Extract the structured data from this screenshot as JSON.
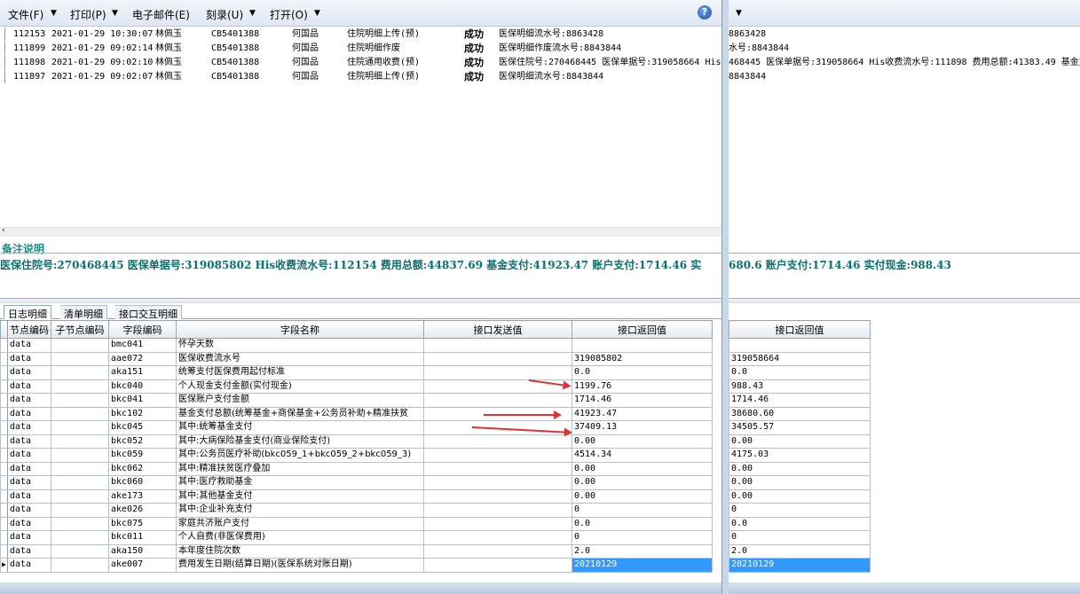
{
  "menu": {
    "file": "文件(F)",
    "print": "打印(P)",
    "email": "电子邮件(E)",
    "burn": "刻录(U)",
    "open": "打开(O)",
    "dropdown": "▼",
    "help_icon": "?"
  },
  "log_rows": [
    {
      "id": "112153",
      "time": "2021-01-29 10:30:07",
      "user": "林佩玉",
      "card": "CB5401388",
      "doctor": "何国品",
      "op": "住院明细上传(预)",
      "status": "成功",
      "msg": "医保明细流水号:8863428"
    },
    {
      "id": "111899",
      "time": "2021-01-29 09:02:14",
      "user": "林佩玉",
      "card": "CB5401388",
      "doctor": "何国品",
      "op": "住院明细作废",
      "status": "成功",
      "msg": "医保明细作废流水号:8843844"
    },
    {
      "id": "111898",
      "time": "2021-01-29 09:02:10",
      "user": "林佩玉",
      "card": "CB5401388",
      "doctor": "何国品",
      "op": "住院通用收费(预)",
      "status": "成功",
      "msg": "医保住院号:270468445 医保单据号:319058664 His"
    },
    {
      "id": "111897",
      "time": "2021-01-29 09:02:07",
      "user": "林佩玉",
      "card": "CB5401388",
      "doctor": "何国品",
      "op": "住院明细上传(预)",
      "status": "成功",
      "msg": "医保明细流水号:8843844"
    }
  ],
  "right_log_rows": [
    "8863428",
    "水号:8843844",
    "468445 医保单据号:319058664 His收费流水号:111898 费用总额:41383.49 基金支",
    "8843844"
  ],
  "remark": {
    "title": "备注说明",
    "text": "医保住院号:270468445 医保单据号:319085802 His收费流水号:112154 费用总额:44837.69 基金支付:41923.47 账户支付:1714.46 实",
    "right_text": "680.6 账户支付:1714.46 实付现金:988.43"
  },
  "tabs": [
    "日志明细",
    "清单明细",
    "接口交互明细"
  ],
  "grid_headers": [
    "节点编码",
    "子节点编码",
    "字段编码",
    "字段名称",
    "接口发送值",
    "接口返回值"
  ],
  "right_grid_header": "接口返回值",
  "grid_rows": [
    {
      "node": "data",
      "sub": "",
      "code": "bmc041",
      "name": "怀孕天数",
      "send": "",
      "ret": "",
      "ret2": ""
    },
    {
      "node": "data",
      "sub": "",
      "code": "aae072",
      "name": "医保收费流水号",
      "send": "",
      "ret": "319085802",
      "ret2": "319058664"
    },
    {
      "node": "data",
      "sub": "",
      "code": "aka151",
      "name": "统筹支付医保费用起付标准",
      "send": "",
      "ret": "0.0",
      "ret2": "0.0"
    },
    {
      "node": "data",
      "sub": "",
      "code": "bkc040",
      "name": "个人现金支付金额(实付现金)",
      "send": "",
      "ret": "1199.76",
      "ret2": "988.43"
    },
    {
      "node": "data",
      "sub": "",
      "code": "bkc041",
      "name": "医保账户支付金额",
      "send": "",
      "ret": "1714.46",
      "ret2": "1714.46"
    },
    {
      "node": "data",
      "sub": "",
      "code": "bkc102",
      "name": "基金支付总额(统筹基金+商保基金+公务员补助+精准扶贫",
      "send": "",
      "ret": "41923.47",
      "ret2": "38680.60"
    },
    {
      "node": "data",
      "sub": "",
      "code": "bkc045",
      "name": "其中:统筹基金支付",
      "send": "",
      "ret": "37409.13",
      "ret2": "34505.57"
    },
    {
      "node": "data",
      "sub": "",
      "code": "bkc052",
      "name": "其中:大病保险基金支付(商业保险支付)",
      "send": "",
      "ret": "0.00",
      "ret2": "0.00"
    },
    {
      "node": "data",
      "sub": "",
      "code": "bkc059",
      "name": "其中:公务员医疗补助(bkc059_1+bkc059_2+bkc059_3)",
      "send": "",
      "ret": "4514.34",
      "ret2": "4175.03"
    },
    {
      "node": "data",
      "sub": "",
      "code": "bkc062",
      "name": "其中:精准扶贫医疗叠加",
      "send": "",
      "ret": "0.00",
      "ret2": "0.00"
    },
    {
      "node": "data",
      "sub": "",
      "code": "bkc060",
      "name": "其中:医疗救助基金",
      "send": "",
      "ret": "0.00",
      "ret2": "0.00"
    },
    {
      "node": "data",
      "sub": "",
      "code": "ake173",
      "name": "其中:其他基金支付",
      "send": "",
      "ret": "0.00",
      "ret2": "0.00"
    },
    {
      "node": "data",
      "sub": "",
      "code": "ake026",
      "name": "其中:企业补充支付",
      "send": "",
      "ret": "0",
      "ret2": "0"
    },
    {
      "node": "data",
      "sub": "",
      "code": "bkc075",
      "name": "家庭共济账户支付",
      "send": "",
      "ret": "0.0",
      "ret2": "0.0"
    },
    {
      "node": "data",
      "sub": "",
      "code": "bkc011",
      "name": "个人自费(非医保费用)",
      "send": "",
      "ret": "0",
      "ret2": "0"
    },
    {
      "node": "data",
      "sub": "",
      "code": "aka150",
      "name": "本年度住院次数",
      "send": "",
      "ret": "2.0",
      "ret2": "2.0"
    },
    {
      "node": "data",
      "sub": "",
      "code": "ake007",
      "name": "费用发生日期(结算日期)(医保系统对账日期)",
      "send": "",
      "ret": "20210129",
      "ret2": "20210129"
    }
  ],
  "colors": {
    "remark": "#0a7070",
    "selection": "#3399ff",
    "arrow": "#e03030"
  }
}
